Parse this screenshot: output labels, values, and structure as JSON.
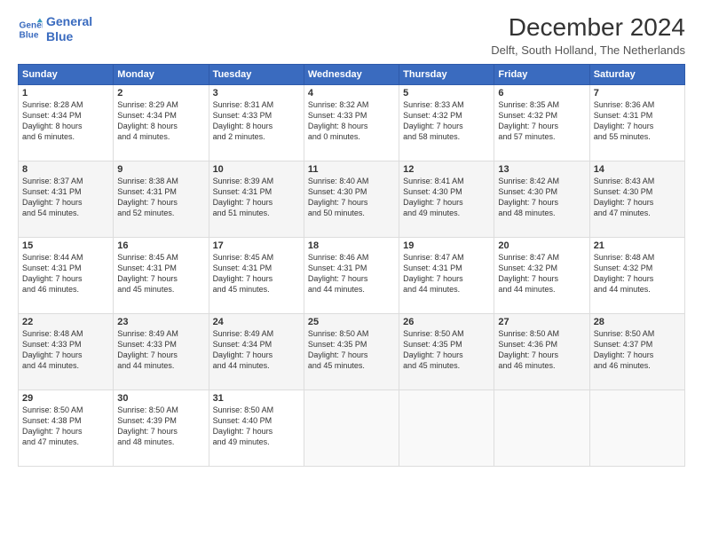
{
  "header": {
    "logo_line1": "General",
    "logo_line2": "Blue",
    "title": "December 2024",
    "subtitle": "Delft, South Holland, The Netherlands"
  },
  "calendar": {
    "days_of_week": [
      "Sunday",
      "Monday",
      "Tuesday",
      "Wednesday",
      "Thursday",
      "Friday",
      "Saturday"
    ],
    "weeks": [
      [
        null,
        {
          "day": 2,
          "sunrise": "8:29 AM",
          "sunset": "4:34 PM",
          "daylight": "8 hours and 4 minutes."
        },
        {
          "day": 3,
          "sunrise": "8:31 AM",
          "sunset": "4:33 PM",
          "daylight": "8 hours and 2 minutes."
        },
        {
          "day": 4,
          "sunrise": "8:32 AM",
          "sunset": "4:33 PM",
          "daylight": "8 hours and 0 minutes."
        },
        {
          "day": 5,
          "sunrise": "8:33 AM",
          "sunset": "4:32 PM",
          "daylight": "7 hours and 58 minutes."
        },
        {
          "day": 6,
          "sunrise": "8:35 AM",
          "sunset": "4:32 PM",
          "daylight": "7 hours and 57 minutes."
        },
        {
          "day": 7,
          "sunrise": "8:36 AM",
          "sunset": "4:31 PM",
          "daylight": "7 hours and 55 minutes."
        }
      ],
      [
        {
          "day": 1,
          "sunrise": "8:28 AM",
          "sunset": "4:34 PM",
          "daylight": "8 hours and 6 minutes."
        },
        null,
        null,
        null,
        null,
        null,
        null
      ],
      [
        {
          "day": 8,
          "sunrise": "8:37 AM",
          "sunset": "4:31 PM",
          "daylight": "7 hours and 54 minutes."
        },
        {
          "day": 9,
          "sunrise": "8:38 AM",
          "sunset": "4:31 PM",
          "daylight": "7 hours and 52 minutes."
        },
        {
          "day": 10,
          "sunrise": "8:39 AM",
          "sunset": "4:31 PM",
          "daylight": "7 hours and 51 minutes."
        },
        {
          "day": 11,
          "sunrise": "8:40 AM",
          "sunset": "4:30 PM",
          "daylight": "7 hours and 50 minutes."
        },
        {
          "day": 12,
          "sunrise": "8:41 AM",
          "sunset": "4:30 PM",
          "daylight": "7 hours and 49 minutes."
        },
        {
          "day": 13,
          "sunrise": "8:42 AM",
          "sunset": "4:30 PM",
          "daylight": "7 hours and 48 minutes."
        },
        {
          "day": 14,
          "sunrise": "8:43 AM",
          "sunset": "4:30 PM",
          "daylight": "7 hours and 47 minutes."
        }
      ],
      [
        {
          "day": 15,
          "sunrise": "8:44 AM",
          "sunset": "4:31 PM",
          "daylight": "7 hours and 46 minutes."
        },
        {
          "day": 16,
          "sunrise": "8:45 AM",
          "sunset": "4:31 PM",
          "daylight": "7 hours and 45 minutes."
        },
        {
          "day": 17,
          "sunrise": "8:45 AM",
          "sunset": "4:31 PM",
          "daylight": "7 hours and 45 minutes."
        },
        {
          "day": 18,
          "sunrise": "8:46 AM",
          "sunset": "4:31 PM",
          "daylight": "7 hours and 44 minutes."
        },
        {
          "day": 19,
          "sunrise": "8:47 AM",
          "sunset": "4:31 PM",
          "daylight": "7 hours and 44 minutes."
        },
        {
          "day": 20,
          "sunrise": "8:47 AM",
          "sunset": "4:32 PM",
          "daylight": "7 hours and 44 minutes."
        },
        {
          "day": 21,
          "sunrise": "8:48 AM",
          "sunset": "4:32 PM",
          "daylight": "7 hours and 44 minutes."
        }
      ],
      [
        {
          "day": 22,
          "sunrise": "8:48 AM",
          "sunset": "4:33 PM",
          "daylight": "7 hours and 44 minutes."
        },
        {
          "day": 23,
          "sunrise": "8:49 AM",
          "sunset": "4:33 PM",
          "daylight": "7 hours and 44 minutes."
        },
        {
          "day": 24,
          "sunrise": "8:49 AM",
          "sunset": "4:34 PM",
          "daylight": "7 hours and 44 minutes."
        },
        {
          "day": 25,
          "sunrise": "8:50 AM",
          "sunset": "4:35 PM",
          "daylight": "7 hours and 45 minutes."
        },
        {
          "day": 26,
          "sunrise": "8:50 AM",
          "sunset": "4:35 PM",
          "daylight": "7 hours and 45 minutes."
        },
        {
          "day": 27,
          "sunrise": "8:50 AM",
          "sunset": "4:36 PM",
          "daylight": "7 hours and 46 minutes."
        },
        {
          "day": 28,
          "sunrise": "8:50 AM",
          "sunset": "4:37 PM",
          "daylight": "7 hours and 46 minutes."
        }
      ],
      [
        {
          "day": 29,
          "sunrise": "8:50 AM",
          "sunset": "4:38 PM",
          "daylight": "7 hours and 47 minutes."
        },
        {
          "day": 30,
          "sunrise": "8:50 AM",
          "sunset": "4:39 PM",
          "daylight": "7 hours and 48 minutes."
        },
        {
          "day": 31,
          "sunrise": "8:50 AM",
          "sunset": "4:40 PM",
          "daylight": "7 hours and 49 minutes."
        },
        null,
        null,
        null,
        null
      ]
    ]
  }
}
